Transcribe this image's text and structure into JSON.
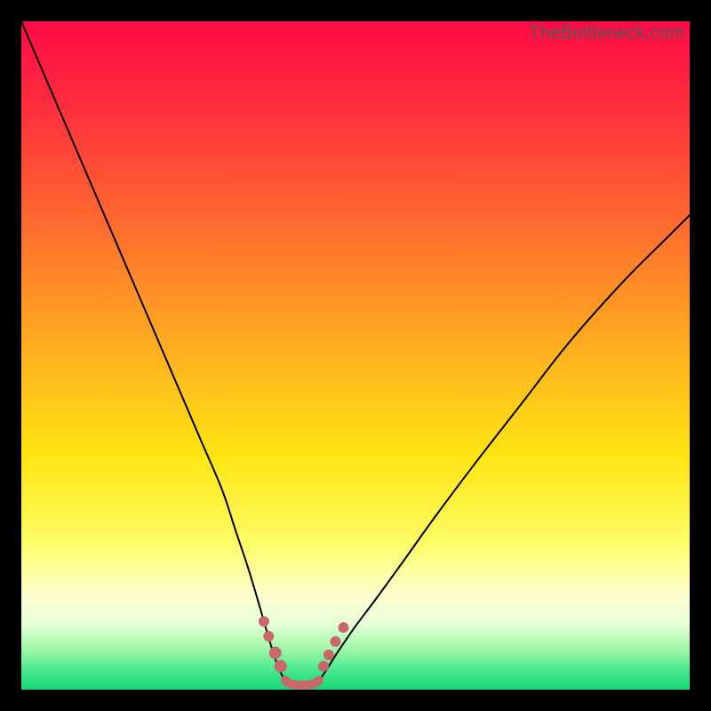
{
  "watermark": "TheBottleneck.com",
  "chart_data": {
    "type": "line",
    "title": "",
    "xlabel": "",
    "ylabel": "",
    "xlim": [
      0,
      100
    ],
    "ylim": [
      0,
      100
    ],
    "grid": false,
    "legend": false,
    "background_gradient_stops": [
      {
        "pct": 0,
        "color": "#ff0b46"
      },
      {
        "pct": 12,
        "color": "#ff2b3e"
      },
      {
        "pct": 30,
        "color": "#ff6a2f"
      },
      {
        "pct": 50,
        "color": "#ffb21f"
      },
      {
        "pct": 65,
        "color": "#ffe512"
      },
      {
        "pct": 78,
        "color": "#fdfd66"
      },
      {
        "pct": 86,
        "color": "#fdfed0"
      },
      {
        "pct": 90,
        "color": "#e8ffd8"
      },
      {
        "pct": 94,
        "color": "#9ff7a8"
      },
      {
        "pct": 97,
        "color": "#4be88f"
      },
      {
        "pct": 100,
        "color": "#17d778"
      }
    ],
    "series": [
      {
        "name": "left-curve",
        "color": "#000000",
        "x": [
          0,
          3,
          6,
          9,
          12,
          15,
          18,
          21,
          24,
          27,
          30,
          32,
          34,
          35.5,
          36.5,
          37.3,
          38.0,
          38.6,
          39.1,
          39.5
        ],
        "y": [
          100,
          93,
          86,
          79,
          72,
          65,
          58,
          51,
          44,
          37,
          30,
          24,
          18,
          13,
          9.5,
          6.8,
          4.6,
          3.0,
          2.0,
          1.4
        ]
      },
      {
        "name": "right-curve",
        "color": "#000000",
        "x": [
          44.5,
          45.0,
          45.8,
          46.8,
          48.2,
          50,
          53,
          57,
          62,
          68,
          75,
          82,
          90,
          97,
          100
        ],
        "y": [
          1.4,
          2.0,
          3.2,
          4.8,
          6.9,
          9.5,
          13.5,
          19,
          26,
          34,
          43,
          52,
          61,
          68,
          71
        ]
      },
      {
        "name": "valley-floor",
        "color": "#c9686b",
        "stroke_width": 10,
        "x": [
          39.5,
          40.2,
          41.4,
          42.6,
          43.8,
          44.5
        ],
        "y": [
          1.4,
          0.9,
          0.7,
          0.7,
          0.9,
          1.4
        ]
      }
    ],
    "annotations": [
      {
        "name": "left-dot-1",
        "shape": "circle",
        "x": 36.3,
        "y": 10.2,
        "r": 6,
        "color": "#c9686b"
      },
      {
        "name": "left-dot-2",
        "shape": "circle",
        "x": 37.0,
        "y": 8.0,
        "r": 6,
        "color": "#c9686b"
      },
      {
        "name": "left-dot-3",
        "shape": "circle",
        "x": 38.0,
        "y": 5.5,
        "r": 7,
        "color": "#c9686b"
      },
      {
        "name": "left-dot-4",
        "shape": "circle",
        "x": 38.8,
        "y": 3.5,
        "r": 7,
        "color": "#c9686b"
      },
      {
        "name": "right-dot-1",
        "shape": "circle",
        "x": 45.2,
        "y": 3.5,
        "r": 6,
        "color": "#c9686b"
      },
      {
        "name": "right-dot-2",
        "shape": "circle",
        "x": 46.0,
        "y": 5.2,
        "r": 6,
        "color": "#c9686b"
      },
      {
        "name": "right-dot-3",
        "shape": "circle",
        "x": 47.0,
        "y": 7.2,
        "r": 6,
        "color": "#c9686b"
      },
      {
        "name": "right-dot-4",
        "shape": "circle",
        "x": 48.2,
        "y": 9.3,
        "r": 6,
        "color": "#c9686b"
      }
    ]
  }
}
